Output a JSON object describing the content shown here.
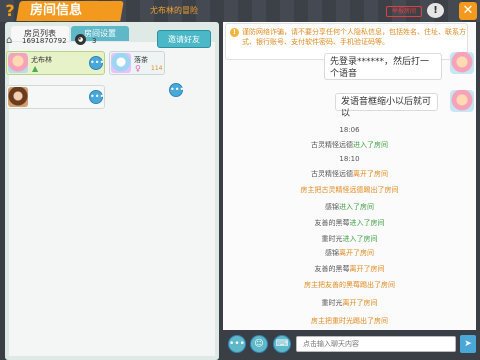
{
  "header": {
    "title": "房间信息",
    "subtitle": "尤布林的冒险",
    "report_label": "举报房间"
  },
  "tabs": [
    {
      "label": "房员列表"
    },
    {
      "label": "房间设置"
    }
  ],
  "room": {
    "id": "1691870792",
    "player_count": "3",
    "invite_label": "邀请好友"
  },
  "players": [
    {
      "name": "尤布林",
      "score": ""
    },
    {
      "name": "落茶",
      "score": "114"
    },
    {
      "name": "",
      "score": ""
    }
  ],
  "chat": {
    "notice": "谨防网络诈骗，请不要分享任何个人隐私信息，包括姓名、住址、联系方式、银行账号、支付软件密码、手机验证码等。",
    "messages": [
      {
        "text": "先登录******，然后打一个语音"
      },
      {
        "text": "发语音框缩小以后就可以"
      }
    ],
    "events": [
      {
        "type": "time",
        "text": "18:06"
      },
      {
        "actor": "古灵精怪远德",
        "action": "进入了房间",
        "kind": "join"
      },
      {
        "type": "time",
        "text": "18:10"
      },
      {
        "actor": "古灵精怪远德",
        "action": "离开了房间",
        "kind": "leave"
      },
      {
        "actor": "房主把古灵精怪远德",
        "action": "踢出了房间",
        "kind": "leave"
      },
      {
        "actor": "感锦",
        "action": "进入了房间",
        "kind": "join"
      },
      {
        "actor": "友善的黑莓",
        "action": "进入了房间",
        "kind": "join"
      },
      {
        "actor": "重时光",
        "action": "进入了房间",
        "kind": "join"
      },
      {
        "actor": "感锦",
        "action": "离开了房间",
        "kind": "leave"
      },
      {
        "actor": "友善的黑莓",
        "action": "离开了房间",
        "kind": "leave"
      },
      {
        "actor": "房主把友善的黑莓",
        "action": "踢出了房间",
        "kind": "leave"
      },
      {
        "actor": "重时光",
        "action": "离开了房间",
        "kind": "leave"
      },
      {
        "actor": "房主把重时光",
        "action": "踢出了房间",
        "kind": "leave"
      }
    ],
    "input_placeholder": "点击输入聊天内容"
  },
  "colors": {
    "accent": "#f39a1e",
    "teal": "#5fb8c8",
    "join": "#43a047",
    "leave": "#e08a20"
  }
}
